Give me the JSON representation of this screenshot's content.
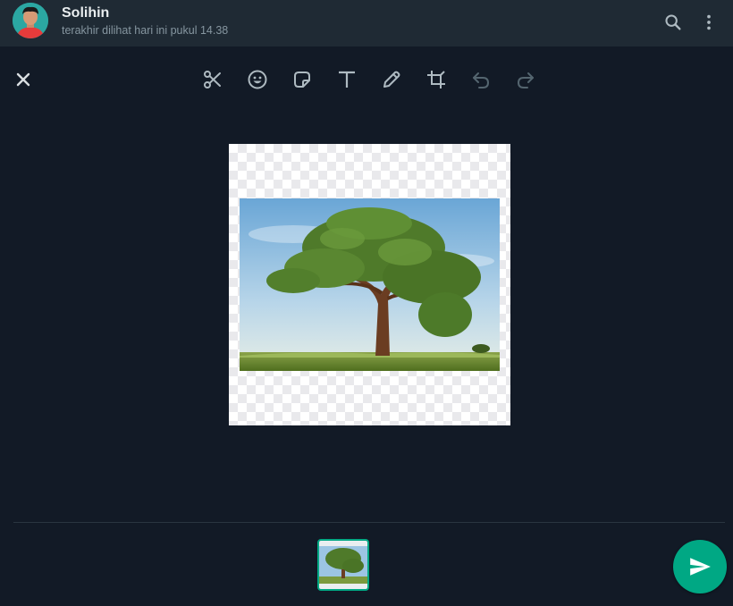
{
  "header": {
    "contact_name": "Solihin",
    "last_seen": "terakhir dilihat hari ini pukul 14.38",
    "icons": [
      "search-icon",
      "menu-icon"
    ]
  },
  "toolbar": {
    "close_icon": "close-icon",
    "tools": [
      "scissors-icon",
      "emoji-icon",
      "sticker-icon",
      "text-icon",
      "pencil-icon",
      "crop-icon",
      "undo-icon",
      "redo-icon"
    ]
  },
  "media": {
    "image_subject": "tree-photo"
  },
  "colors": {
    "background": "#121a26",
    "header": "#1f2a34",
    "accent": "#00a884",
    "icon": "#aebac1",
    "icon_disabled": "#54656f"
  }
}
